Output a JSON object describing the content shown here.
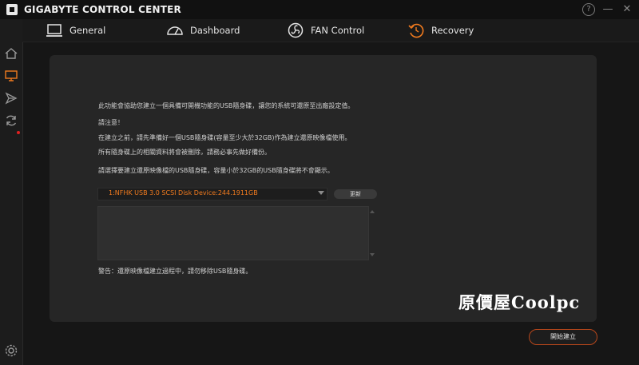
{
  "app": {
    "title": "GIGABYTE CONTROL CENTER",
    "help": "?",
    "minimize": "—",
    "close": "✕"
  },
  "nav": {
    "tabs": [
      {
        "label": "General",
        "icon": "laptop-icon"
      },
      {
        "label": "Dashboard",
        "icon": "gauge-icon"
      },
      {
        "label": "FAN Control",
        "icon": "fan-icon"
      },
      {
        "label": "Recovery",
        "icon": "recovery-icon"
      }
    ],
    "accent": "#f07a1e"
  },
  "sidebar": {
    "items": [
      "home-icon",
      "monitor-icon",
      "send-icon",
      "update-icon",
      "settings-icon"
    ],
    "active": "monitor-icon"
  },
  "content": {
    "lines": [
      "此功能會協助您建立一個具備可開機功能的USB隨身碟，讓您的系統可還原至出廠設定值。",
      "請注意！",
      "在建立之前，請先準備好一個USB隨身碟(容量至少大於32GB)作為建立還原映像檔使用。",
      "所有隨身碟上的相關資料將會被刪除，請務必事先做好備份。",
      "請選擇要建立還原映像檔的USB隨身碟，容量小於32GB的USB隨身碟將不會顯示。"
    ],
    "usb_selected": "1:NFHK USB 3.0 SCSI Disk Device:244.1911GB",
    "refresh_label": "更新",
    "warning": "警告：還原映像檔建立過程中，請勿移除USB隨身碟。"
  },
  "watermark": "原價屋Coolpc",
  "start_label": "開始建立"
}
